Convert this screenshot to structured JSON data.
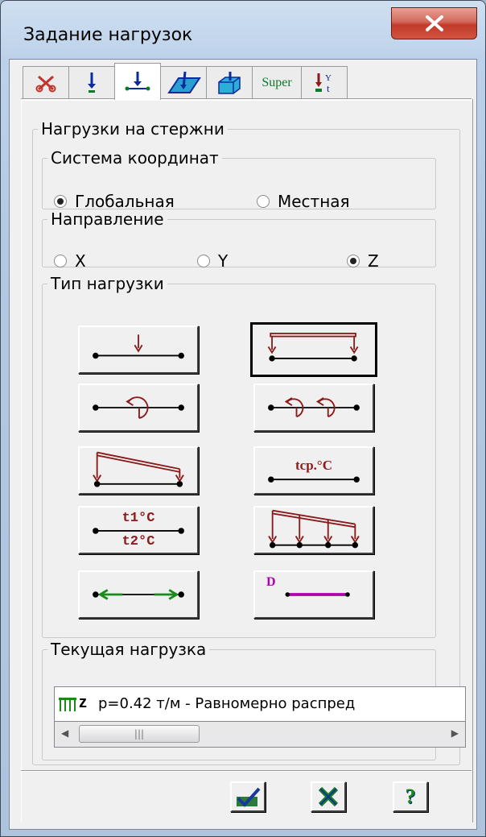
{
  "window": {
    "title": "Задание нагрузок",
    "close_label": "X"
  },
  "tabs": [
    {
      "icon": "scissors-icon",
      "label": ""
    },
    {
      "icon": "node-load-icon",
      "label": ""
    },
    {
      "icon": "bar-load-icon",
      "label": ""
    },
    {
      "icon": "plate-load-icon",
      "label": ""
    },
    {
      "icon": "solid-load-icon",
      "label": ""
    },
    {
      "icon": "super-icon",
      "label": "Super"
    },
    {
      "icon": "temperature-load-icon",
      "label": ""
    }
  ],
  "page": {
    "title": "Нагрузки на стержни"
  },
  "coords": {
    "title": "Система координат",
    "global": "Глобальная",
    "local": "Местная",
    "selected": "global"
  },
  "direction": {
    "title": "Направление",
    "x": "X",
    "y": "Y",
    "z": "Z",
    "selected": "z"
  },
  "load_type": {
    "title": "Тип нагрузки",
    "buttons": [
      {
        "name": "concentrated-force-button",
        "label": ""
      },
      {
        "name": "uniform-distributed-button",
        "label": "",
        "selected": true
      },
      {
        "name": "concentrated-moment-button",
        "label": ""
      },
      {
        "name": "distributed-moment-button",
        "label": ""
      },
      {
        "name": "trapezoidal-load-button",
        "label": ""
      },
      {
        "name": "uniform-temperature-button",
        "label": "tср.°C"
      },
      {
        "name": "temperature-gradient-button",
        "label_top": "t1°C",
        "label_bottom": "t2°C"
      },
      {
        "name": "multi-trapezoidal-button",
        "label": ""
      },
      {
        "name": "axial-force-button",
        "label": ""
      },
      {
        "name": "displacement-button",
        "label": "D"
      }
    ]
  },
  "current": {
    "title": "Текущая нагрузка",
    "badge": "z",
    "text": "p=0.42 т/м - Равномерно распред"
  },
  "footer": {
    "apply": "apply",
    "delete": "delete",
    "help": "?"
  },
  "colors": {
    "dark_red": "#8b1a1a",
    "green": "#1a8a1a",
    "magenta": "#b000b0"
  }
}
